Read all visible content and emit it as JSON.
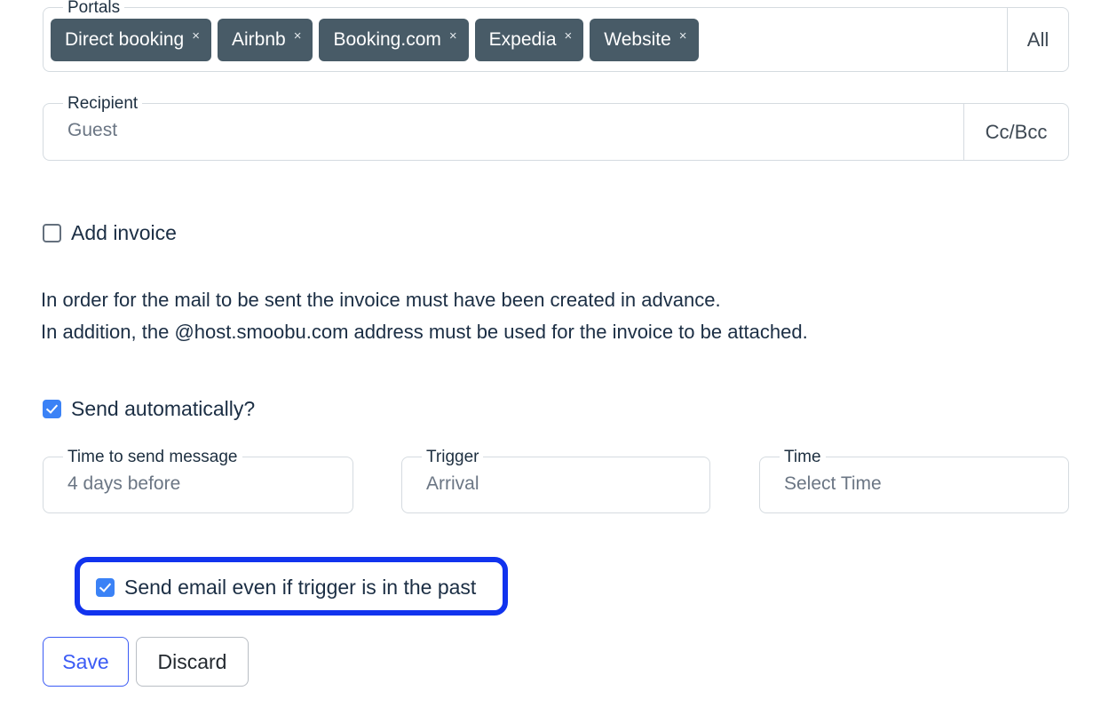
{
  "portals": {
    "legend": "Portals",
    "chips": [
      {
        "label": "Direct booking",
        "remove_icon": "×"
      },
      {
        "label": "Airbnb",
        "remove_icon": "×"
      },
      {
        "label": "Booking.com",
        "remove_icon": "×"
      },
      {
        "label": "Expedia",
        "remove_icon": "×"
      },
      {
        "label": "Website",
        "remove_icon": "×"
      }
    ],
    "all_button": "All",
    "chip_bg": "#485b67"
  },
  "recipient": {
    "legend": "Recipient",
    "value": "Guest",
    "ccbcc_button": "Cc/Bcc"
  },
  "add_invoice": {
    "label": "Add invoice",
    "checked": false
  },
  "invoice_note": {
    "line1": "In order for the mail to be sent the invoice must have been created in advance.",
    "line2": "In addition, the @host.smoobu.com address must be used for the invoice to be attached."
  },
  "send_automatically": {
    "label": "Send automatically?",
    "checked": true
  },
  "schedule": {
    "time_to_send": {
      "legend": "Time to send message",
      "value": "4 days before"
    },
    "trigger": {
      "legend": "Trigger",
      "value": "Arrival"
    },
    "time": {
      "legend": "Time",
      "value": "Select Time"
    }
  },
  "past_trigger": {
    "label": "Send email even if trigger is in the past",
    "checked": true,
    "highlight_color": "#1133ee"
  },
  "actions": {
    "save": "Save",
    "discard": "Discard",
    "save_color": "#3b5bf5"
  }
}
